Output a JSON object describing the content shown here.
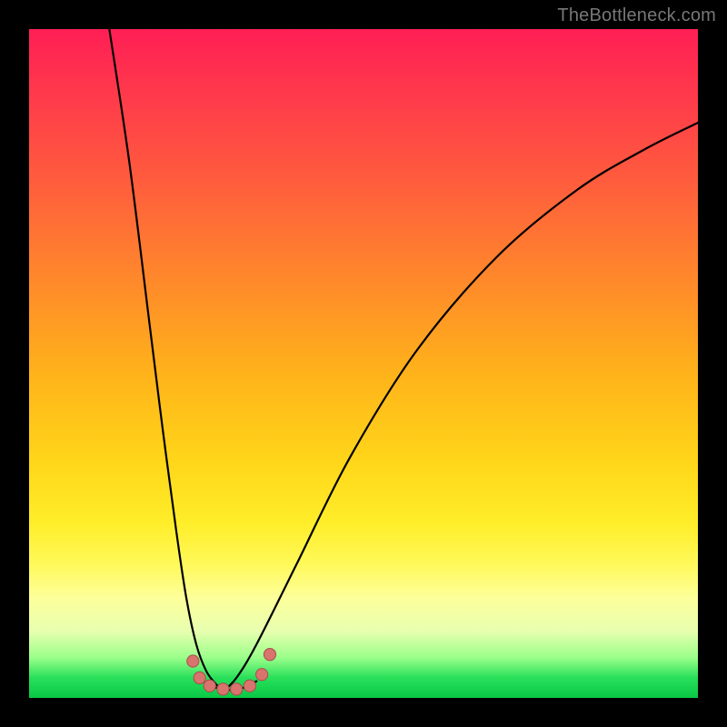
{
  "watermark": "TheBottleneck.com",
  "colors": {
    "background": "#000000",
    "curve": "#000000",
    "marker_fill": "#d9736d",
    "marker_stroke": "#a74f4a",
    "gradient_stops": [
      "#ff1f55",
      "#ff5a3e",
      "#ffb41a",
      "#ffee2a",
      "#fdff9a",
      "#28e05a"
    ]
  },
  "chart_data": {
    "type": "line",
    "title": "",
    "xlabel": "",
    "ylabel": "",
    "xlim": [
      0,
      100
    ],
    "ylim": [
      0,
      100
    ],
    "grid": false,
    "legend": false,
    "series": [
      {
        "name": "left-branch",
        "x": [
          12,
          15,
          18,
          20,
          22,
          23.5,
          25,
          26.5,
          28,
          29
        ],
        "y": [
          100,
          80,
          56,
          40,
          25,
          15,
          8,
          4,
          2,
          1
        ],
        "note": "y is vertical position as % from bottom; steep descending curve"
      },
      {
        "name": "right-branch",
        "x": [
          29,
          31,
          34,
          40,
          48,
          58,
          70,
          82,
          92,
          100
        ],
        "y": [
          1,
          3,
          8,
          20,
          36,
          52,
          66,
          76,
          82,
          86
        ],
        "note": "rising curve, concave, approaches ~86% at right edge"
      },
      {
        "name": "valley-floor",
        "x": [
          26,
          28,
          30,
          32,
          34
        ],
        "y": [
          2.5,
          1.5,
          1.2,
          1.5,
          2.5
        ],
        "note": "shallow U along bottom between branches"
      }
    ],
    "markers": {
      "name": "valley-markers",
      "points": [
        {
          "x": 24.5,
          "y": 5.5
        },
        {
          "x": 25.5,
          "y": 3.0
        },
        {
          "x": 27.0,
          "y": 1.8
        },
        {
          "x": 29.0,
          "y": 1.3
        },
        {
          "x": 31.0,
          "y": 1.3
        },
        {
          "x": 33.0,
          "y": 1.8
        },
        {
          "x": 34.8,
          "y": 3.5
        },
        {
          "x": 36.0,
          "y": 6.5
        }
      ],
      "radius_pct": 0.9
    }
  }
}
